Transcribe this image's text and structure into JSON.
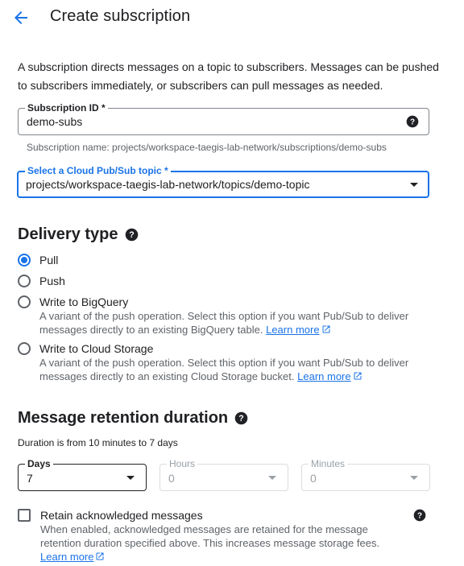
{
  "header": {
    "title": "Create subscription",
    "back_icon": "arrow-back-icon"
  },
  "intro_text": "A subscription directs messages on a topic to subscribers. Messages can be pushed to subscribers immediately, or subscribers can pull messages as needed.",
  "subscription_id": {
    "label": "Subscription ID *",
    "value": "demo-subs",
    "help_icon": "help-icon",
    "hint": "Subscription name: projects/workspace-taegis-lab-network/subscriptions/demo-subs"
  },
  "topic": {
    "label": "Select a Cloud Pub/Sub topic *",
    "value": "projects/workspace-taegis-lab-network/topics/demo-topic",
    "accent_color": "#1a73e8"
  },
  "delivery": {
    "title": "Delivery type",
    "options": [
      {
        "label": "Pull",
        "checked": true
      },
      {
        "label": "Push",
        "checked": false
      },
      {
        "label": "Write to BigQuery",
        "checked": false,
        "desc": "A variant of the push operation. Select this option if you want Pub/Sub to deliver messages directly to an existing BigQuery table.",
        "link": "Learn more"
      },
      {
        "label": "Write to Cloud Storage",
        "checked": false,
        "desc": "A variant of the push operation. Select this option if you want Pub/Sub to deliver messages directly to an existing Cloud Storage bucket.",
        "link": "Learn more"
      }
    ]
  },
  "retention": {
    "title": "Message retention duration",
    "note": "Duration is from 10 minutes to 7 days",
    "days": {
      "label": "Days",
      "value": "7"
    },
    "hours": {
      "label": "Hours",
      "value": "0"
    },
    "minutes": {
      "label": "Minutes",
      "value": "0"
    },
    "retain": {
      "label": "Retain acknowledged messages",
      "checked": false,
      "desc": "When enabled, acknowledged messages are retained for the message retention duration specified above. This increases message storage fees.",
      "link": "Learn more"
    }
  }
}
